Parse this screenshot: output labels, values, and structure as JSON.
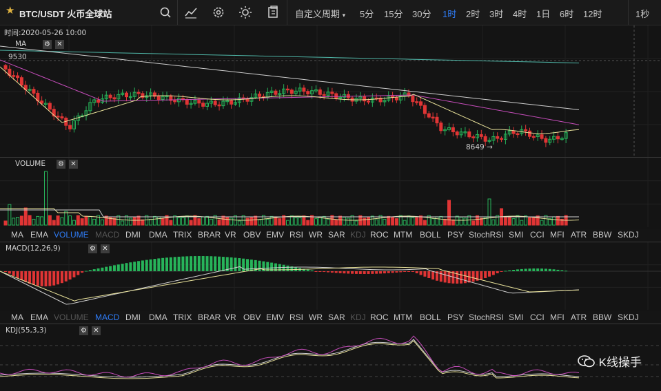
{
  "header": {
    "symbol": "BTC/USDT 火币全球站",
    "custom_period": "自定义周期",
    "periods": [
      "5分",
      "15分",
      "30分",
      "1时",
      "2时",
      "3时",
      "4时",
      "1日",
      "6时",
      "12时"
    ],
    "active_period": "1时",
    "right_period": "1秒"
  },
  "main": {
    "time_label": "时间:2020-05-26 10:00",
    "ma_label": "MA",
    "price_high": "9530",
    "price_low": "8649 →"
  },
  "volume": {
    "label": "VOLUME"
  },
  "macd": {
    "label": "MACD(12,26,9)"
  },
  "kdj": {
    "label": "KDJ(55,3,3)"
  },
  "indicator_tabs": [
    "MA",
    "EMA",
    "VOLUME",
    "MACD",
    "DMI",
    "DMA",
    "TRIX",
    "BRAR",
    "VR",
    "OBV",
    "EMV",
    "RSI",
    "WR",
    "SAR",
    "KDJ",
    "ROC",
    "MTM",
    "BOLL",
    "PSY",
    "StochRSI",
    "SMI",
    "CCI",
    "MFI",
    "ATR",
    "BBW",
    "SKDJ"
  ],
  "indicator_tabs_state_1": {
    "active": "VOLUME",
    "dim": [
      "MACD",
      "KDJ"
    ]
  },
  "indicator_tabs_state_2": {
    "active": "MACD",
    "dim": [
      "VOLUME",
      "KDJ"
    ]
  },
  "watermark": "K线操手",
  "colors": {
    "up": "#27b45a",
    "down": "#e03535",
    "accent": "#2f7cf6",
    "bg": "#141414"
  },
  "chart_data": {
    "type": "candlestick",
    "y_label_high": 9530,
    "y_label_low": 8649,
    "candles_close_trend": [
      9530,
      9470,
      9380,
      9250,
      9180,
      9150,
      9200,
      9260,
      9300,
      9310,
      9320,
      9330,
      9350,
      9340,
      9330,
      9320,
      9310,
      9300,
      9330,
      9360,
      9370,
      9310,
      9200,
      9080,
      8900,
      8700,
      8780,
      8820,
      8850,
      8870,
      8800,
      8790,
      8850,
      8900
    ],
    "note_unused": ""
  }
}
